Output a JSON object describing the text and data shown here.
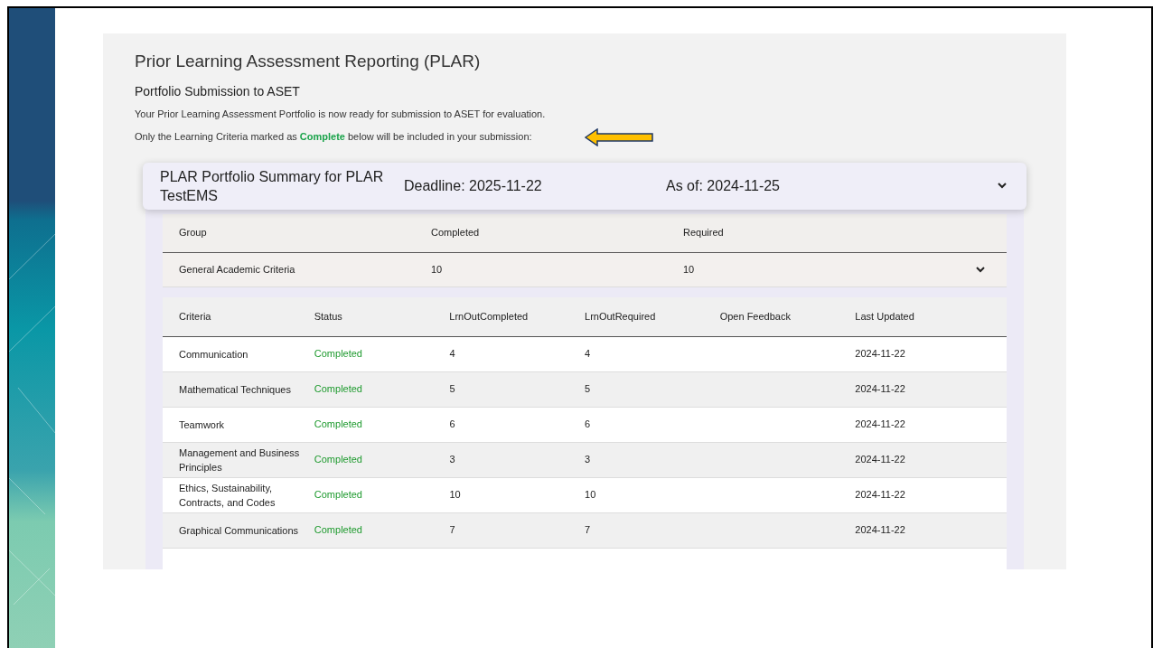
{
  "page": {
    "title": "Prior Learning Assessment Reporting (PLAR)",
    "subtitle": "Portfolio Submission to ASET",
    "intro": "Your Prior Learning Assessment Portfolio is now ready for submission to ASET for evaluation.",
    "note": "Only the Learning Criteria marked as **Complete** below will be included in your submission:"
  },
  "summary": {
    "title": "PLAR Portfolio Summary for PLAR TestEMS",
    "deadline": "Deadline: 2025-11-22",
    "as_of": "As of: 2024-11-25",
    "expanded": true
  },
  "group_table": {
    "columns": [
      "Group",
      "Completed",
      "Required"
    ],
    "rows": [
      {
        "cells": [
          "General Academic Criteria",
          "10",
          "10"
        ],
        "expanded": true
      }
    ]
  },
  "criteria_table": {
    "columns": [
      "Criteria",
      "Status",
      "LrnOutCompleted",
      "LrnOutRequired",
      "Open Feedback",
      "Last Updated"
    ],
    "rows": [
      {
        "criteria": "Communication",
        "status": "Completed",
        "completed": "4",
        "required": "4",
        "last_updated": "2024-11-22"
      },
      {
        "criteria": "Mathematical Techniques",
        "status": "Completed",
        "completed": "5",
        "required": "5",
        "last_updated": "2024-11-22"
      },
      {
        "criteria": "Teamwork",
        "status": "Completed",
        "completed": "6",
        "required": "6",
        "last_updated": "2024-11-22"
      },
      {
        "criteria": "Management and Business Principles",
        "status": "Completed",
        "completed": "3",
        "required": "3",
        "last_updated": "2024-11-22"
      },
      {
        "criteria": "Ethics, Sustainability, Contracts, and Codes",
        "status": "Completed",
        "completed": "10",
        "required": "10",
        "last_updated": "2024-11-22"
      },
      {
        "criteria": "Graphical Communications",
        "status": "Completed",
        "completed": "7",
        "required": "7",
        "last_updated": "2024-11-22"
      }
    ]
  }
}
